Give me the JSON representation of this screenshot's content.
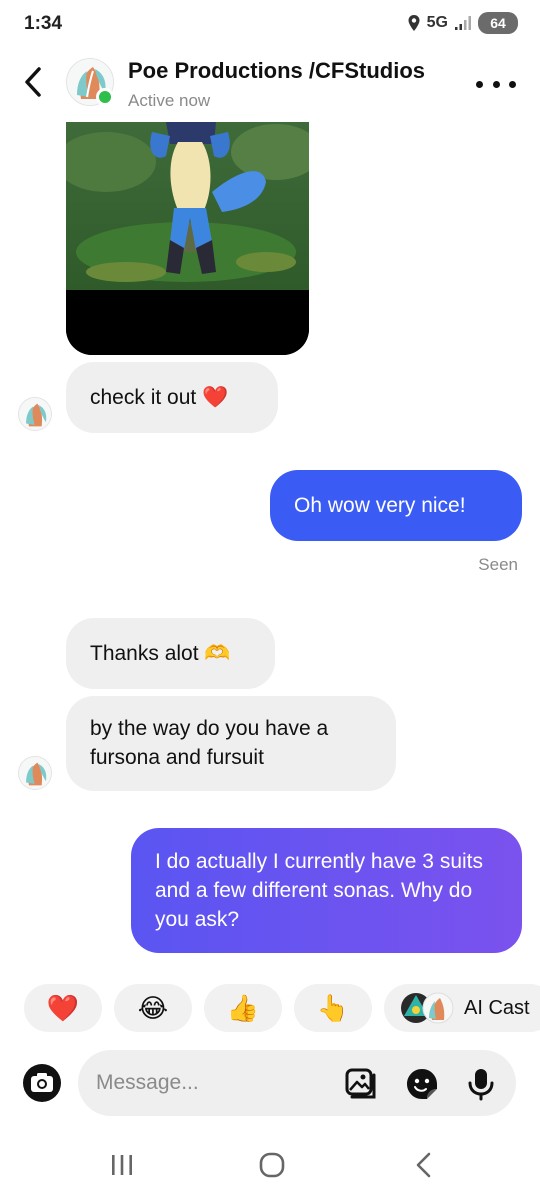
{
  "status_bar": {
    "time": "1:34",
    "network": "5G",
    "battery": "64"
  },
  "header": {
    "contact_name": "Poe Productions /CFStudios",
    "status": "Active now"
  },
  "messages": [
    {
      "type": "image",
      "direction": "incoming"
    },
    {
      "direction": "incoming",
      "text": "check it out ❤️"
    },
    {
      "direction": "outgoing",
      "text": "Oh wow very nice!"
    },
    {
      "direction": "incoming",
      "text": "Thanks alot 🫶"
    },
    {
      "direction": "incoming",
      "text": "by the way do you have a fursona and fursuit"
    },
    {
      "direction": "outgoing",
      "text": "I do actually I currently have 3 suits and a few different sonas. Why do you ask?"
    }
  ],
  "seen_label": "Seen",
  "quick_reactions": [
    "❤️",
    "😂",
    "👍",
    "👆"
  ],
  "ai_chip": {
    "label": "AI Cast"
  },
  "composer": {
    "placeholder": "Message..."
  },
  "colors": {
    "outgoing_blue": "#3b5bf5",
    "outgoing_purple": "#7350f0",
    "incoming_bubble": "#efefef",
    "online": "#2dbf4a"
  },
  "icons": {
    "back": "chevron-left-icon",
    "more": "more-dots-icon",
    "camera": "camera-icon",
    "gallery": "gallery-icon",
    "sticker": "sticker-icon",
    "mic": "microphone-icon",
    "nav_recent": "recent-apps-icon",
    "nav_home": "home-icon",
    "nav_back": "nav-back-icon"
  }
}
